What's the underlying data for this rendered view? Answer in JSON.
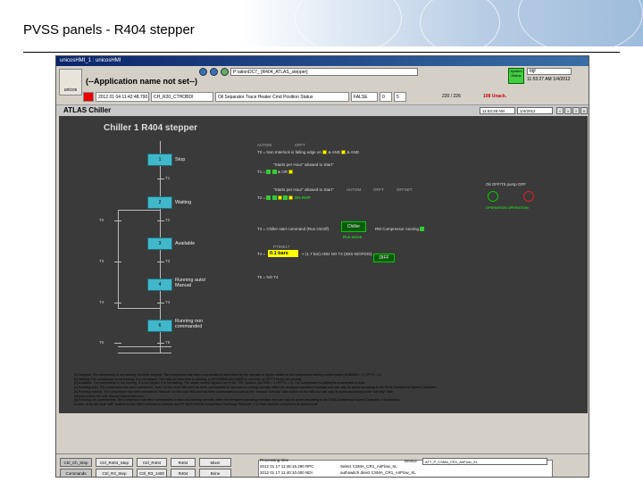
{
  "slide": {
    "title": "PVSS panels - R404 stepper"
  },
  "window": {
    "title": "unicosHMI_1 : unicosHMI",
    "app_name": "(--Application name not set--)",
    "path": "P:\\ationDC7_ [R404_ATLAS_stepper]",
    "status_label": "System Status",
    "user": "fdjf",
    "time": "11:53:27 AM  1/4/2012",
    "logo_text": "unicos"
  },
  "alert": {
    "time": "2012 01 04 11:42:48.790",
    "device": "CH_R20_CTHOBDI",
    "description": "Oil Separator Trace Heater Cmd Position Status",
    "state": "FALSE",
    "count1": "0",
    "count2": "5",
    "total": "220 / 226",
    "unack": "108 Unack."
  },
  "menuband": {
    "label": "ATLAS Chiller",
    "date1": "11:53:28 AM",
    "date2": "1/4/2012",
    "buttons": [
      "<",
      ">",
      "?",
      "X"
    ]
  },
  "panel": {
    "title": "Chiller 1 R404 stepper",
    "steps": [
      {
        "num": "1",
        "label": "Stop"
      },
      {
        "num": "2",
        "label": "Waiting"
      },
      {
        "num": "3",
        "label": "Available"
      },
      {
        "num": "4",
        "label": "Running auto/ Manual"
      },
      {
        "num": "6",
        "label": "Running non commanded"
      }
    ],
    "transitions": [
      "T1",
      "T2",
      "T3",
      "T3",
      "T2",
      "T4",
      "T4",
      "T5",
      "T5"
    ],
    "conditions": {
      "t0": "T0 = Non Interlock is falling edge on",
      "t0_and": "& AND",
      "t0_and2": "& AND",
      "t1": "T1 =",
      "start_hour": "\"Starts per Hour\" allowed to Start\"",
      "t1_and": "& OR",
      "t2": "T2 =",
      "allowed": "\"Starts per Hour\" allowed to Start\"",
      "auto": "AUTOM",
      "off": "OFFT",
      "offset": "OFFSET",
      "valve": "ON ROP",
      "pump_label": "Oil OFF/T5 pump OFF",
      "op_label": "OPERATION OPERATION",
      "t3": "T3 = Chiller start command (Run On/off)",
      "chiller": "Chiller",
      "run_ok": "Run active",
      "compressor": "RM Compressor running",
      "t4": "T4 =",
      "prs_label": "PT5901T",
      "value": "0.1 bars",
      "value_sp": "< (1.7 bar) AND NO T4 (IDIS-N/OFDIS)",
      "diff": "DIFF",
      "t5": "T5 = NO T4"
    },
    "legend": [
      "[1] Stopped: The compressor is not running, it is both stopped. The compressor has been commanded to shut either by the operator or by the switch on the compressor starting control panel (AUBOEN = 0, OFT/T = 0)",
      "[2] Waiting: The compressor is not running. It is not tripped. The start per hour time is running, or (EH+53800 and 53800 is not true), or (OFT4 Pump not running",
      "[3] Available: The compressor is not running. It is not tripped, it is not waiting. The starter control signal is set in the \"ON\" position (AUTOM = 1 OFFT4 = 0). The compressor is waiting for a command to start.",
      "[4] Running auto: The compressor has been selected to \"Auto\" on the local HMI and has been commanded to start and is running normally within the designed operation envelope and can vary its speed according to the R404 Compressor Speed Controller.",
      "[5] Running manual: The compressor has been selected to \"Manual\" on the local HMI and has been commanded to start by the \"manual \"soft key\" start button on the HMI and can vary its speed according to the \"soft key\" fuse.",
      "Manual selects the soft: Manual Speed Selection.",
      "[6] Running non commanded: The compressor has been commanded to start and running normally within the designed operating envelope and can vary its speed according to the R404 Compressor Speed Controller. It is selected",
      "to auto, or by the local \"soft\" buttons on the HMI if selected to manual, and PT 5403: R404s Compressor Discharge Pressure: < 1.7 bars and the compressor is switched off"
    ]
  },
  "bottom": {
    "buttons": [
      {
        "label": "Ctrl_Ch_Step"
      },
      {
        "label": "Ctrl_R404_Step"
      },
      {
        "label": "Ctrl_R404"
      },
      {
        "label": "R404"
      },
      {
        "label": "Mixer"
      },
      {
        "label": "Commands"
      },
      {
        "label": "Ctrl_R3_Step"
      },
      {
        "label": "Ctrl_R3_1400"
      },
      {
        "label": "R404"
      },
      {
        "label": "Brine"
      }
    ],
    "ticker_head": "Processing time",
    "ticker": [
      "2012 01 17   11:46:15.290 RPC",
      "2012 01 17   11:40:10.000 NDI"
    ],
    "ticker_right": [
      "Select CSMA_CR1_AirFlow_XL",
      "authswitch direct CSMA_CR1_AirFlow_XL"
    ],
    "device_label": "Device",
    "device_value": "ATT_P_CSMA_CR1_AirFlow_XL"
  }
}
